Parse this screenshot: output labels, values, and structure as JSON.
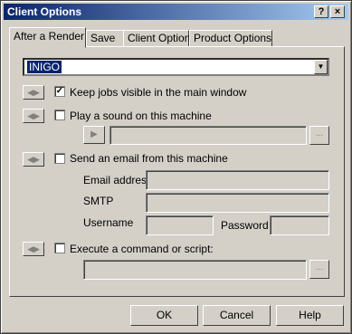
{
  "window": {
    "title": "Client Options",
    "help_button": "?",
    "close_button": "×"
  },
  "tabs": [
    "After a Render",
    "Save",
    "Client Options",
    "Product Options"
  ],
  "client_select": {
    "value": "INIGO"
  },
  "options": {
    "keep_jobs": {
      "label": "Keep jobs visible in the main window",
      "checked": true
    },
    "play_sound": {
      "label": "Play a sound on this machine",
      "checked": false
    },
    "send_email": {
      "label": "Send an email from this machine",
      "checked": false
    },
    "execute": {
      "label": "Execute a command or script:",
      "checked": false
    }
  },
  "email": {
    "address_label": "Email address",
    "smtp_label": "SMTP",
    "username_label": "Username",
    "password_label": "Password"
  },
  "browse_label": "...",
  "buttons": {
    "ok": "OK",
    "cancel": "Cancel",
    "help": "Help"
  }
}
